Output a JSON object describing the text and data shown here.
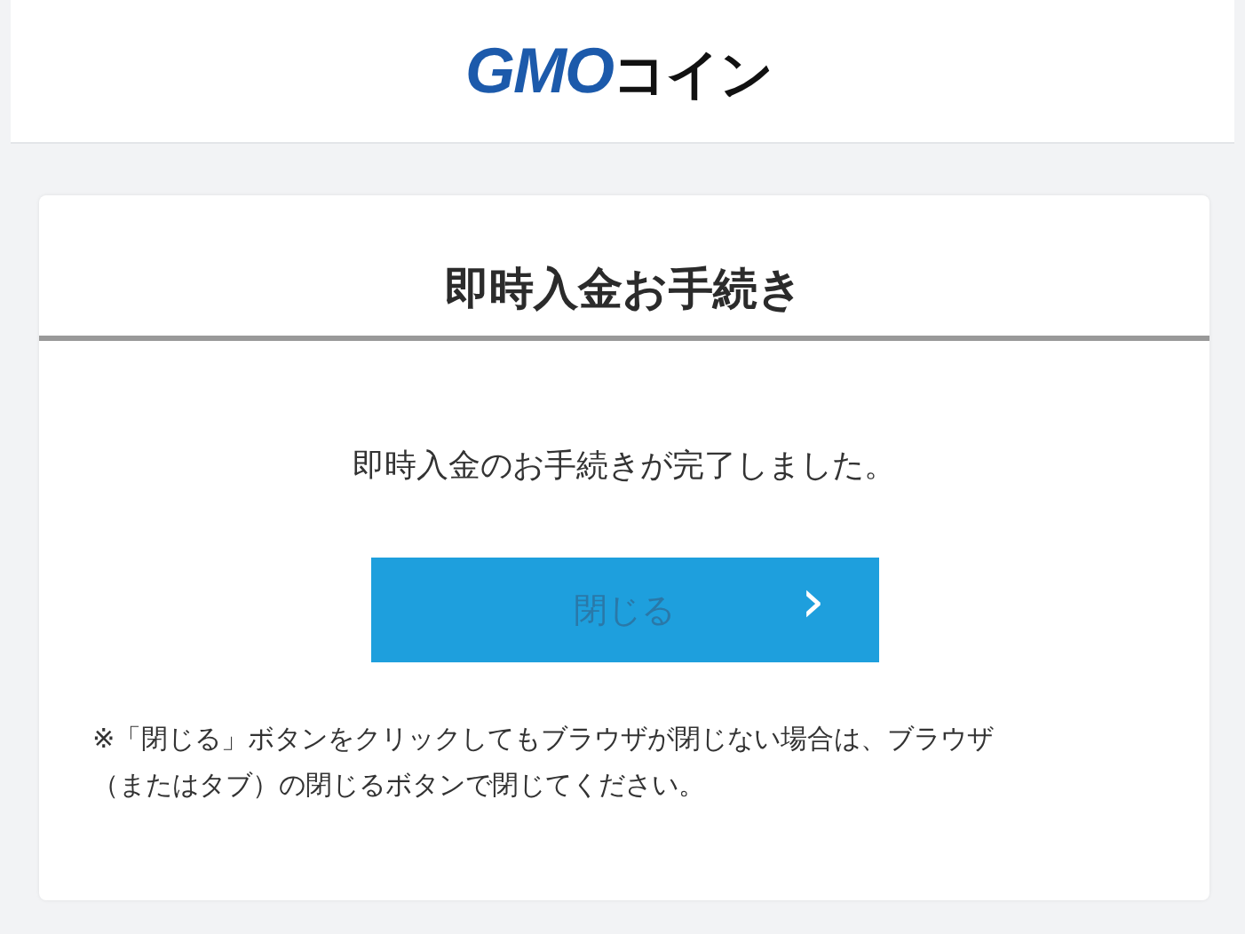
{
  "header": {
    "logo_latin": "GMO",
    "logo_kana": "コイン"
  },
  "card": {
    "title": "即時入金お手続き",
    "message": "即時入金のお手続きが完了しました。",
    "button": {
      "label": "閉じる",
      "chevron": "›"
    },
    "note": "※「閉じる」ボタンをクリックしてもブラウザが閉じない場合は、ブラウザ（またはタブ）の閉じるボタンで閉じてください。"
  }
}
